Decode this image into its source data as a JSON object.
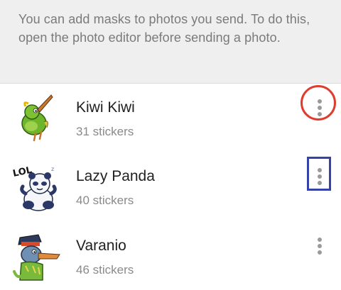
{
  "info": {
    "text": "You can add masks to photos you send. To do this, open the photo editor before sending a photo."
  },
  "packs": [
    {
      "name": "Kiwi Kiwi",
      "count": "31 stickers",
      "thumb_icon": "kiwi-bird-sticker"
    },
    {
      "name": "Lazy Panda",
      "count": "40 stickers",
      "thumb_icon": "panda-sticker",
      "thumb_text": "LOL"
    },
    {
      "name": "Varanio",
      "count": "46 stickers",
      "thumb_icon": "lizard-sticker"
    }
  ],
  "menu_icon": "more-vertical-icon",
  "annotations": {
    "circle_color": "#e03c2e",
    "rect_color": "#3543a8"
  }
}
